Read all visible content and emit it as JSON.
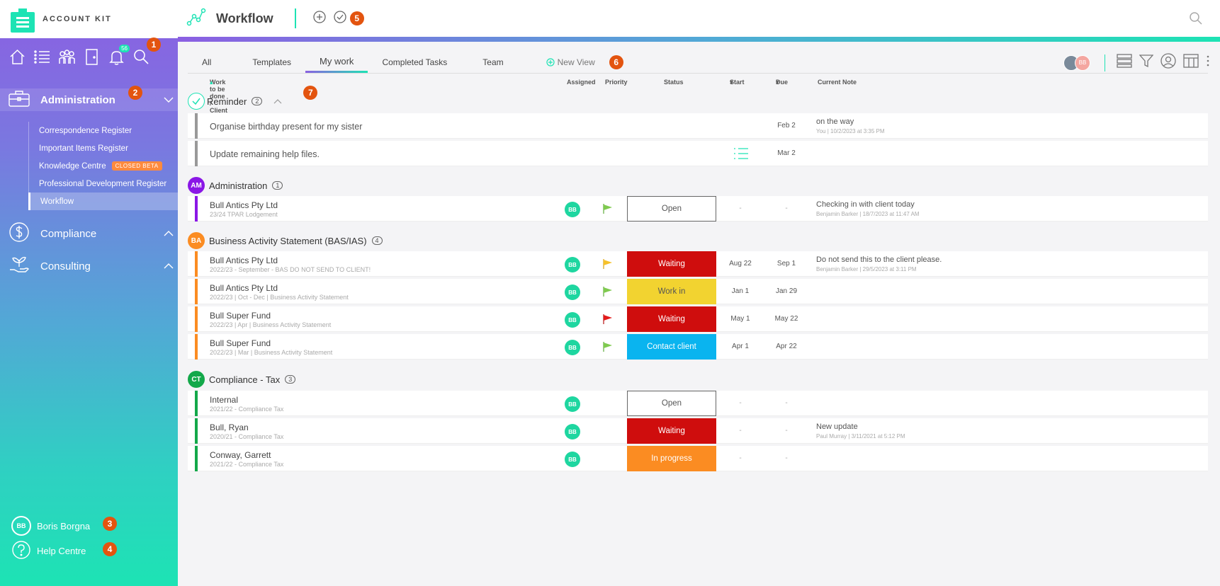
{
  "brand": {
    "name": "ACCOUNT KIT"
  },
  "topbar": {
    "title": "Workflow"
  },
  "sidebar": {
    "notification_count": "56",
    "sections": [
      {
        "label": "Administration"
      },
      {
        "label": "Compliance"
      },
      {
        "label": "Consulting"
      }
    ],
    "admin_items": [
      {
        "label": "Correspondence Register"
      },
      {
        "label": "Important Items Register"
      },
      {
        "label": "Knowledge Centre",
        "badge": "CLOSED BETA"
      },
      {
        "label": "Professional Development Register"
      },
      {
        "label": "Workflow"
      }
    ],
    "user": {
      "initials": "BB",
      "name": "Boris Borgna"
    },
    "help": "Help Centre"
  },
  "callouts": [
    "1",
    "2",
    "3",
    "4",
    "5",
    "6",
    "7"
  ],
  "tabs": [
    {
      "label": "All"
    },
    {
      "label": "Templates"
    },
    {
      "label": "My work"
    },
    {
      "label": "Completed Tasks"
    },
    {
      "label": "Team"
    }
  ],
  "new_view": "New View",
  "toolbar": {
    "avatar_initials": "BB"
  },
  "columns": {
    "work": "Work to be done / Client",
    "assigned": "Assigned",
    "priority": "Priority",
    "status": "Status",
    "start": "Start",
    "due": "Due",
    "note": "Current Note"
  },
  "groups": {
    "reminder": {
      "title": "Reminder",
      "count": "2",
      "rows": [
        {
          "title": "Organise birthday present for my sister",
          "due": "Feb 2",
          "note": "on the way",
          "note_meta": "You | 10/2/2023 at 3:35 PM"
        },
        {
          "title": "Update remaining help files.",
          "due": "Mar 2"
        }
      ]
    },
    "administration": {
      "initials": "AM",
      "title": "Administration",
      "count": "1",
      "rows": [
        {
          "title": "Bull Antics Pty Ltd",
          "sub": "23/24 TPAR Lodgement",
          "assignee": "BB",
          "status": "Open",
          "start": "-",
          "due": "-",
          "note": "Checking in with client today",
          "note_meta": "Benjamin Barker | 18/7/2023 at 11:47 AM"
        }
      ]
    },
    "bas": {
      "initials": "BA",
      "title": "Business Activity Statement (BAS/IAS)",
      "count": "4",
      "rows": [
        {
          "title": "Bull Antics Pty Ltd",
          "sub": "2022/23 - September - BAS DO NOT SEND TO CLIENT!",
          "assignee": "BB",
          "status": "Waiting",
          "start": "Aug 22",
          "due": "Sep 1",
          "note": "Do not send this to the client please.",
          "note_meta": "Benjamin Barker | 29/5/2023 at 3:11 PM"
        },
        {
          "title": "Bull Antics Pty Ltd",
          "sub": "2022/23 | Oct - Dec | Business Activity Statement",
          "assignee": "BB",
          "status": "Work in",
          "start": "Jan 1",
          "due": "Jan 29"
        },
        {
          "title": "Bull Super Fund",
          "sub": "2022/23 | Apr | Business Activity Statement",
          "assignee": "BB",
          "status": "Waiting",
          "start": "May 1",
          "due": "May 22"
        },
        {
          "title": "Bull Super Fund",
          "sub": "2022/23 | Mar | Business Activity Statement",
          "assignee": "BB",
          "status": "Contact client",
          "start": "Apr 1",
          "due": "Apr 22"
        }
      ]
    },
    "tax": {
      "initials": "CT",
      "title": "Compliance - Tax",
      "count": "3",
      "rows": [
        {
          "title": "Internal",
          "sub": "2021/22 - Compliance Tax",
          "assignee": "BB",
          "status": "Open",
          "start": "-",
          "due": "-"
        },
        {
          "title": "Bull, Ryan",
          "sub": "2020/21 - Compliance Tax",
          "assignee": "BB",
          "status": "Waiting",
          "start": "-",
          "due": "-",
          "note": "New update",
          "note_meta": "Paul Murray | 3/11/2021 at 5:12 PM"
        },
        {
          "title": "Conway, Garrett",
          "sub": "2021/22 - Compliance Tax",
          "assignee": "BB",
          "status": "In progress",
          "start": "-",
          "due": "-"
        }
      ]
    }
  },
  "colors": {
    "accent": "#1de3b4",
    "purple": "#8b5fe2",
    "admin_group": "#8a17e6",
    "bas_group": "#fb8c22",
    "tax_group": "#13a84a",
    "waiting": "#cf0d0d",
    "work_in": "#f2d330",
    "contact_client": "#0ab4ef",
    "in_progress": "#fb8c22",
    "callout": "#e3540f"
  }
}
